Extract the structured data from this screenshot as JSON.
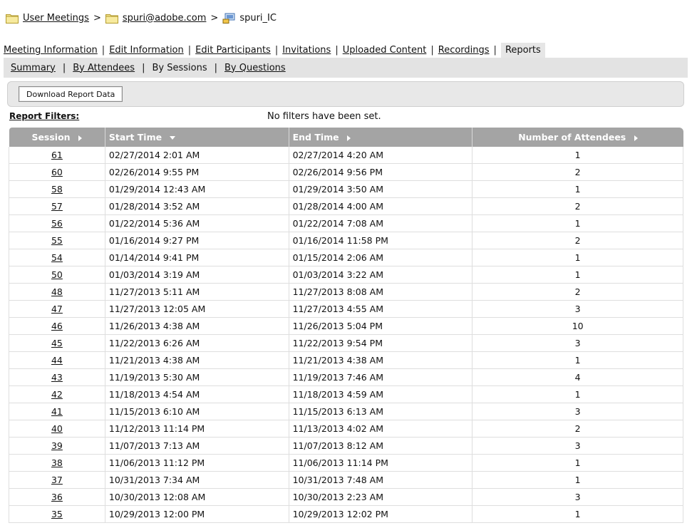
{
  "breadcrumb": {
    "items": [
      "User Meetings",
      "spuri@adobe.com",
      "spuri_IC"
    ],
    "separator": ">"
  },
  "main_tabs": [
    "Meeting Information",
    "Edit Information",
    "Edit Participants",
    "Invitations",
    "Uploaded Content",
    "Recordings",
    "Reports"
  ],
  "main_tabs_active": "Reports",
  "sub_tabs": [
    "Summary",
    "By Attendees",
    "By Sessions",
    "By Questions"
  ],
  "sub_tabs_active": "By Sessions",
  "toolbar": {
    "download_label": "Download Report Data"
  },
  "filters": {
    "label": "Report Filters:",
    "message": "No filters have been set."
  },
  "table": {
    "headers": [
      "Session",
      "Start Time",
      "End Time",
      "Number of Attendees"
    ],
    "sort_column": "Start Time",
    "sort_direction": "descending",
    "rows": [
      [
        "61",
        "02/27/2014 2:01 AM",
        "02/27/2014 4:20 AM",
        "1"
      ],
      [
        "60",
        "02/26/2014 9:55 PM",
        "02/26/2014 9:56 PM",
        "2"
      ],
      [
        "58",
        "01/29/2014 12:43 AM",
        "01/29/2014 3:50 AM",
        "1"
      ],
      [
        "57",
        "01/28/2014 3:52 AM",
        "01/28/2014 4:00 AM",
        "2"
      ],
      [
        "56",
        "01/22/2014 5:36 AM",
        "01/22/2014 7:08 AM",
        "1"
      ],
      [
        "55",
        "01/16/2014 9:27 PM",
        "01/16/2014 11:58 PM",
        "2"
      ],
      [
        "54",
        "01/14/2014 9:41 PM",
        "01/15/2014 2:06 AM",
        "1"
      ],
      [
        "50",
        "01/03/2014 3:19 AM",
        "01/03/2014 3:22 AM",
        "1"
      ],
      [
        "48",
        "11/27/2013 5:11 AM",
        "11/27/2013 8:08 AM",
        "2"
      ],
      [
        "47",
        "11/27/2013 12:05 AM",
        "11/27/2013 4:55 AM",
        "3"
      ],
      [
        "46",
        "11/26/2013 4:38 AM",
        "11/26/2013 5:04 PM",
        "10"
      ],
      [
        "45",
        "11/22/2013 6:26 AM",
        "11/22/2013 9:54 PM",
        "3"
      ],
      [
        "44",
        "11/21/2013 4:38 AM",
        "11/21/2013 4:38 AM",
        "1"
      ],
      [
        "43",
        "11/19/2013 5:30 AM",
        "11/19/2013 7:46 AM",
        "4"
      ],
      [
        "42",
        "11/18/2013 4:54 AM",
        "11/18/2013 4:59 AM",
        "1"
      ],
      [
        "41",
        "11/15/2013 6:10 AM",
        "11/15/2013 6:13 AM",
        "3"
      ],
      [
        "40",
        "11/12/2013 11:14 PM",
        "11/13/2013 4:02 AM",
        "2"
      ],
      [
        "39",
        "11/07/2013 7:13 AM",
        "11/07/2013 8:12 AM",
        "3"
      ],
      [
        "38",
        "11/06/2013 11:12 PM",
        "11/06/2013 11:14 PM",
        "1"
      ],
      [
        "37",
        "10/31/2013 7:34 AM",
        "10/31/2013 7:48 AM",
        "1"
      ],
      [
        "36",
        "10/30/2013 12:08 AM",
        "10/30/2013 2:23 AM",
        "3"
      ],
      [
        "35",
        "10/29/2013 12:00 PM",
        "10/29/2013 12:02 PM",
        "1"
      ]
    ]
  }
}
